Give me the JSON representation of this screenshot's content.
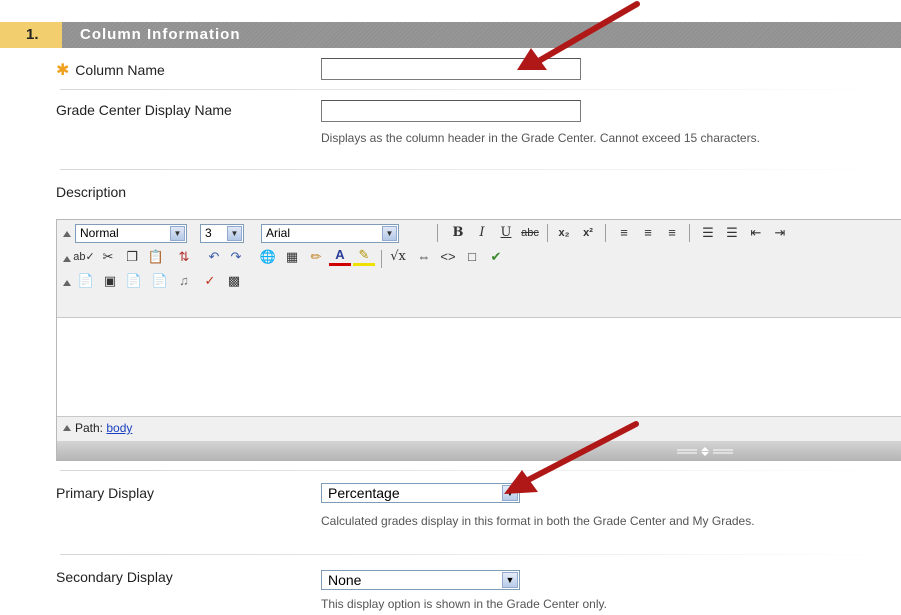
{
  "section": {
    "number": "1.",
    "title": "Column Information"
  },
  "fields": {
    "column_name": {
      "label": "Column Name",
      "value": ""
    },
    "display_name": {
      "label": "Grade Center Display Name",
      "value": "",
      "help": "Displays as the column header in the Grade Center. Cannot exceed 15 characters."
    },
    "description": {
      "label": "Description"
    }
  },
  "editor": {
    "format_select": "Normal",
    "size_select": "3",
    "font_select": "Arial",
    "path_label": "Path:",
    "path_link": "body",
    "toolbar_row1": [
      "bold-icon",
      "italic-icon",
      "underline-icon",
      "strikethrough-icon",
      "subscript-icon",
      "superscript-icon",
      "align-left-icon",
      "align-center-icon",
      "align-right-icon",
      "ordered-list-icon",
      "unordered-list-icon",
      "outdent-icon",
      "indent-icon"
    ],
    "toolbar_row2": [
      "spellcheck-icon",
      "cut-icon",
      "copy-icon",
      "paste-icon",
      "unlink-icon",
      "undo-icon",
      "redo-icon",
      "link-icon",
      "table-icon",
      "pencil-icon",
      "text-color-icon",
      "highlight-icon",
      "equation-icon",
      "source-icon",
      "html-icon",
      "preview-icon",
      "check-icon"
    ],
    "toolbar_row3": [
      "paste-word-icon",
      "image-icon",
      "attach-file-icon",
      "mashup-icon",
      "media-icon",
      "flash-icon",
      "template-icon"
    ]
  },
  "primary_display": {
    "label": "Primary Display",
    "value": "Percentage",
    "help": "Calculated grades display in this format in both the Grade Center and My Grades."
  },
  "secondary_display": {
    "label": "Secondary Display",
    "value": "None",
    "help": "This display option is shown in the Grade Center only."
  },
  "colors": {
    "header_gold": "#f2ce6e",
    "header_gray": "#939393",
    "arrow_red": "#b01818",
    "required_star": "#f0a020"
  }
}
